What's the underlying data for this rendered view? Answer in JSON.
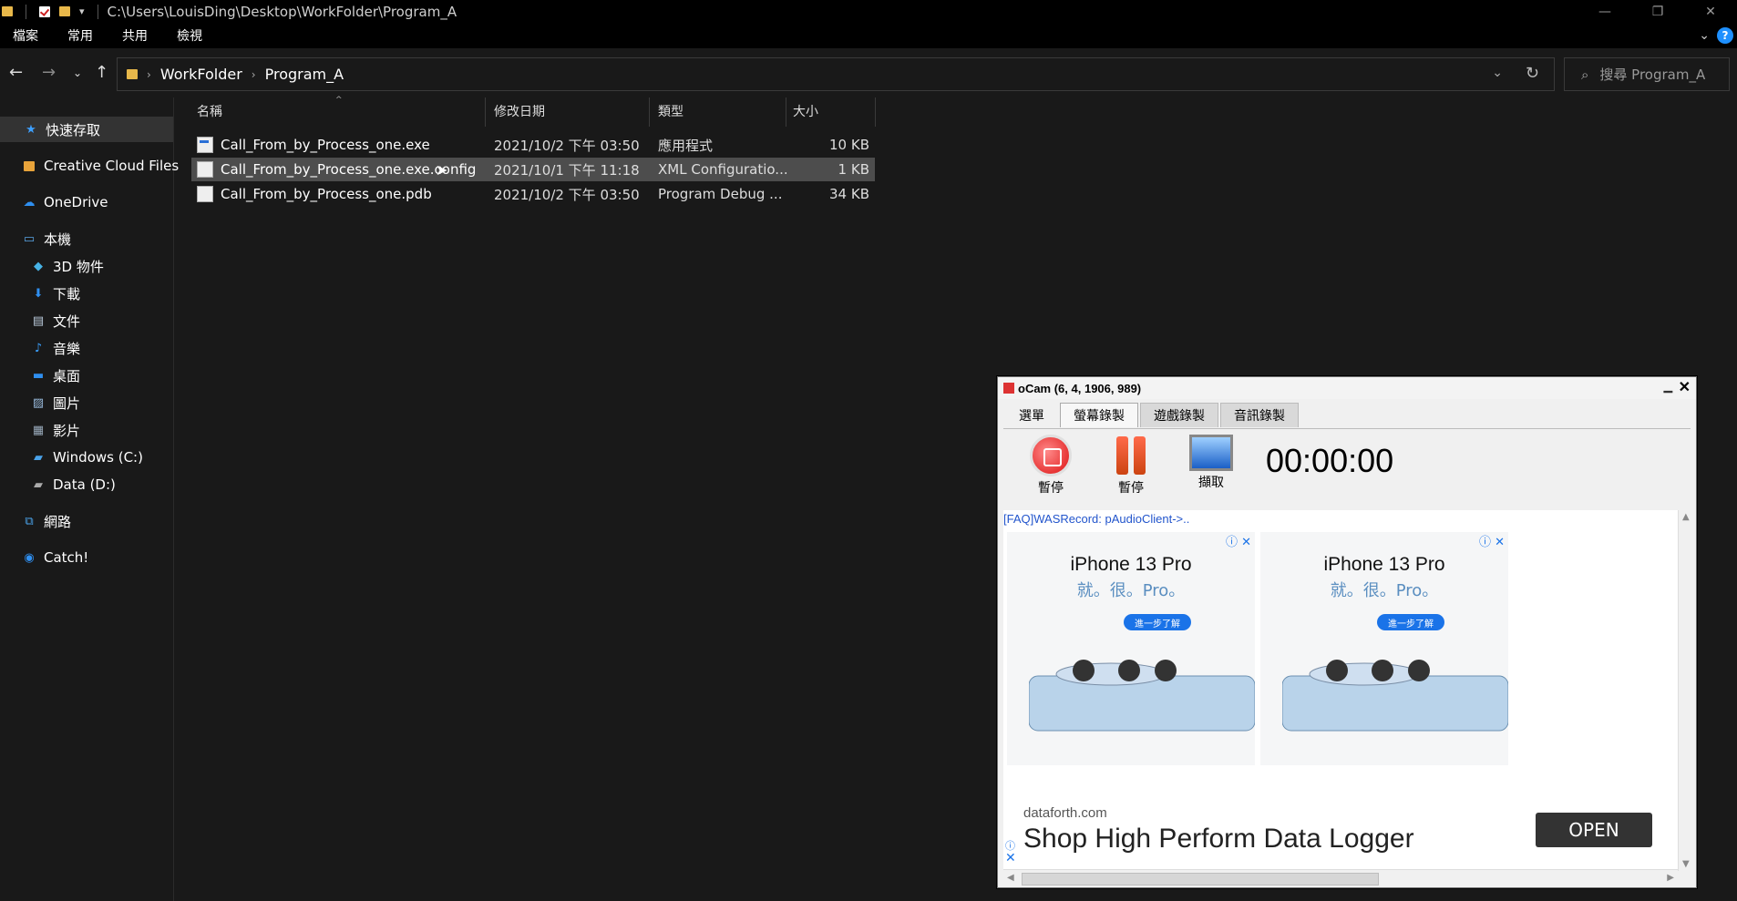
{
  "window": {
    "title_path": "C:\\Users\\LouisDing\\Desktop\\WorkFolder\\Program_A",
    "minimize": "—",
    "maximize": "❐",
    "close": "✕"
  },
  "ribbon": {
    "tabs": [
      "檔案",
      "常用",
      "共用",
      "檢視"
    ],
    "help": "?"
  },
  "address": {
    "breadcrumbs": [
      "WorkFolder",
      "Program_A"
    ]
  },
  "search": {
    "placeholder": "搜尋 Program_A"
  },
  "sidebar": {
    "items": [
      {
        "label": "快速存取",
        "icon": "star-icon"
      },
      {
        "label": "Creative Cloud Files",
        "icon": "creative-cloud-folder-icon"
      },
      {
        "label": "OneDrive",
        "icon": "cloud-icon"
      },
      {
        "label": "本機",
        "icon": "computer-icon"
      },
      {
        "label": "3D 物件",
        "icon": "cube-icon"
      },
      {
        "label": "下載",
        "icon": "download-icon"
      },
      {
        "label": "文件",
        "icon": "document-icon"
      },
      {
        "label": "音樂",
        "icon": "music-icon"
      },
      {
        "label": "桌面",
        "icon": "desktop-icon"
      },
      {
        "label": "圖片",
        "icon": "picture-icon"
      },
      {
        "label": "影片",
        "icon": "video-icon"
      },
      {
        "label": "Windows (C:)",
        "icon": "drive-icon"
      },
      {
        "label": "Data (D:)",
        "icon": "drive-icon"
      },
      {
        "label": "網路",
        "icon": "network-icon"
      },
      {
        "label": "Catch!",
        "icon": "catch-icon"
      }
    ]
  },
  "filelist": {
    "columns": [
      "名稱",
      "修改日期",
      "類型",
      "大小"
    ],
    "rows": [
      {
        "name": "Call_From_by_Process_one.exe",
        "date": "2021/10/2 下午 03:50",
        "type": "應用程式",
        "size": "10 KB"
      },
      {
        "name": "Call_From_by_Process_one.exe.config",
        "date": "2021/10/1 下午 11:18",
        "type": "XML Configuratio...",
        "size": "1 KB"
      },
      {
        "name": "Call_From_by_Process_one.pdb",
        "date": "2021/10/2 下午 03:50",
        "type": "Program Debug ...",
        "size": "34 KB"
      }
    ]
  },
  "ocam": {
    "title": "oCam (6, 4, 1906, 989)",
    "tabs": [
      "選單",
      "螢幕錄製",
      "遊戲錄製",
      "音訊錄製"
    ],
    "stop_label": "暫停",
    "pause_label": "暫停",
    "capture_label": "擷取",
    "timer": "00:00:00",
    "faq": "[FAQ]WASRecord: pAudioClient->..",
    "ads": [
      {
        "headline": "iPhone 13 Pro",
        "sub": "就。很。Pro。",
        "button": "進一步了解"
      },
      {
        "headline": "iPhone 13 Pro",
        "sub": "就。很。Pro。",
        "button": "進一步了解"
      }
    ],
    "banner": {
      "domain": "dataforth.com",
      "headline": "Shop High Perform Data Logger",
      "button": "OPEN"
    }
  }
}
